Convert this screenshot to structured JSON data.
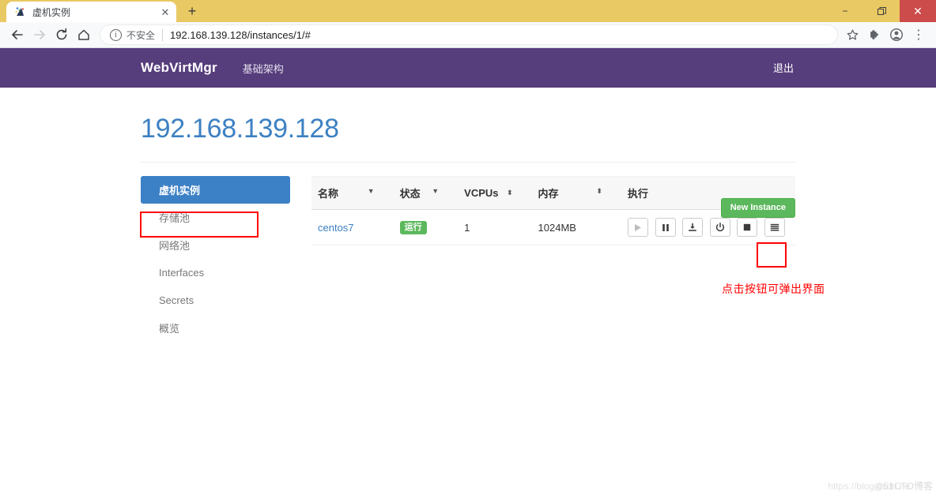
{
  "browser": {
    "tab": {
      "title": "虚机实例",
      "favicon": "site-favicon",
      "close": "✕"
    },
    "new_tab": "+",
    "window_controls": {
      "minimize": "−",
      "maximize": "❐",
      "close": "✕"
    },
    "nav": {
      "back": "←",
      "forward": "→",
      "reload": "⟳",
      "home": "⌂"
    },
    "omnibox": {
      "info_icon": "i",
      "security_label": "不安全",
      "url": "192.168.139.128/instances/1/#"
    },
    "toolbar_right": {
      "bookmark": "☆",
      "extensions": "puzzle-icon",
      "profile": "profile-icon",
      "menu": "⋮"
    }
  },
  "navbar": {
    "brand": "WebVirtMgr",
    "links": [
      "基础架构"
    ],
    "logout": "退出",
    "background": "#563d7c"
  },
  "header": {
    "title": "192.168.139.128",
    "new_instance_label": "New Instance",
    "new_instance_color": "#5cb85c"
  },
  "sidebar": {
    "items": [
      {
        "label": "虚机实例",
        "active": true
      },
      {
        "label": "存储池",
        "active": false
      },
      {
        "label": "网络池",
        "active": false
      },
      {
        "label": "Interfaces",
        "active": false
      },
      {
        "label": "Secrets",
        "active": false
      },
      {
        "label": "概览",
        "active": false
      }
    ],
    "active_color": "#3c80c6"
  },
  "table": {
    "columns": [
      {
        "label": "名称",
        "sort": "▼"
      },
      {
        "label": "状态",
        "sort": "▼"
      },
      {
        "label": "VCPUs",
        "sort": "⬍"
      },
      {
        "label": "内存",
        "sort": "⬍"
      },
      {
        "label": "执行",
        "sort": ""
      }
    ],
    "rows": [
      {
        "name": "centos7",
        "state": "运行",
        "state_color": "#5cb85c",
        "vcpus": "1",
        "memory": "1024MB",
        "actions": [
          {
            "name": "start-button",
            "icon": "play",
            "enabled": false
          },
          {
            "name": "pause-button",
            "icon": "pause",
            "enabled": true
          },
          {
            "name": "snapshot-button",
            "icon": "download",
            "enabled": true
          },
          {
            "name": "poweroff-button",
            "icon": "power",
            "enabled": true
          },
          {
            "name": "forceoff-button",
            "icon": "stop",
            "enabled": true
          },
          {
            "name": "more-menu-button",
            "icon": "hamburger",
            "enabled": true
          }
        ]
      }
    ]
  },
  "annotations": {
    "note": "点击按钮可弹出界面",
    "color": "#ff0000"
  },
  "watermark": {
    "line1": "https://blog.csdn.ne",
    "line2": "@51CTO博客"
  }
}
